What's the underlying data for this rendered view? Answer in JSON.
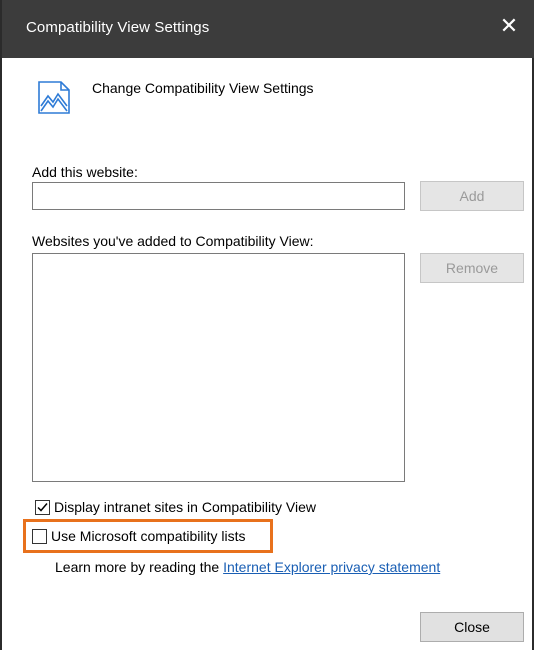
{
  "window": {
    "title": "Compatibility View Settings",
    "close_glyph": "✕"
  },
  "header": {
    "icon": "compatibility-view-icon",
    "text": "Change Compatibility View Settings"
  },
  "add_site": {
    "label": "Add this website:",
    "value": "",
    "button_label": "Add",
    "button_enabled": false
  },
  "sites_list": {
    "label": "Websites you've added to Compatibility View:",
    "items": [],
    "remove_label": "Remove",
    "remove_enabled": false
  },
  "options": {
    "intranet": {
      "label": "Display intranet sites in Compatibility View",
      "checked": true
    },
    "ms_lists": {
      "label": "Use Microsoft compatibility lists",
      "checked": false,
      "highlighted": true,
      "highlight_color": "#e8711c"
    }
  },
  "learn_more": {
    "prefix": "Learn more by reading the",
    "link_text": "Internet Explorer privacy statement"
  },
  "footer": {
    "close_label": "Close"
  },
  "colors": {
    "titlebar": "#3c3c3c",
    "link": "#1a5fb4",
    "highlight": "#e8711c"
  }
}
